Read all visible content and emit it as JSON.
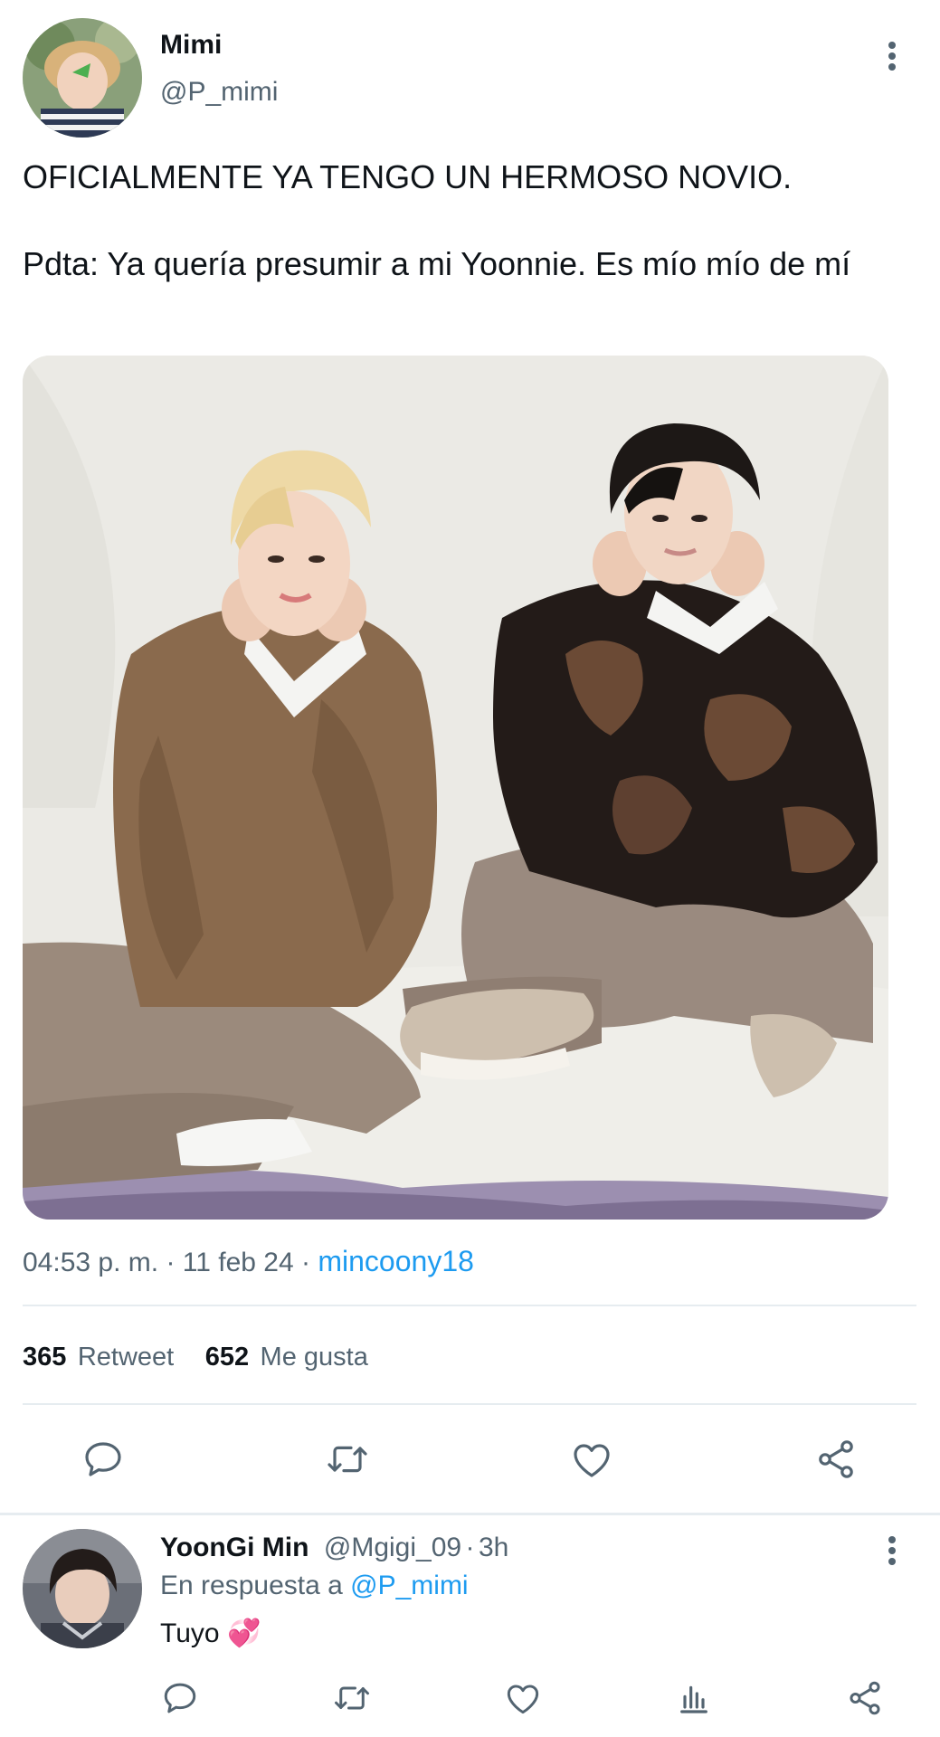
{
  "tweet": {
    "author_name": "Mimi",
    "author_handle": "@P_mimi",
    "text_line1": "OFICIALMENTE YA TENGO UN HERMOSO NOVIO.",
    "text_line2": "Pdta: Ya quería presumir a mi Yoonnie. Es mío mío de mí",
    "time": "04:53 p. m.",
    "separator1": "·",
    "date": "11 feb 24",
    "separator2": "·",
    "source": "mincoony18",
    "retweet_count": "365",
    "retweet_label": "Retweet",
    "like_count": "652",
    "like_label": "Me gusta"
  },
  "reply": {
    "author_name": "YoonGi Min",
    "author_handle": "@Mgigi_09",
    "separator": "·",
    "time": "3h",
    "in_reply_prefix": "En respuesta a",
    "in_reply_handle": "@P_mimi",
    "text": "Tuyo",
    "emoji": "💞"
  },
  "icons": {
    "more": "more-vertical-icon",
    "reply": "reply-icon",
    "retweet": "retweet-icon",
    "like": "heart-icon",
    "share": "share-icon",
    "analytics": "analytics-icon"
  },
  "colors": {
    "text_primary": "#0f1419",
    "text_secondary": "#536471",
    "link": "#1d9bf0",
    "divider": "#e6ecf0"
  }
}
